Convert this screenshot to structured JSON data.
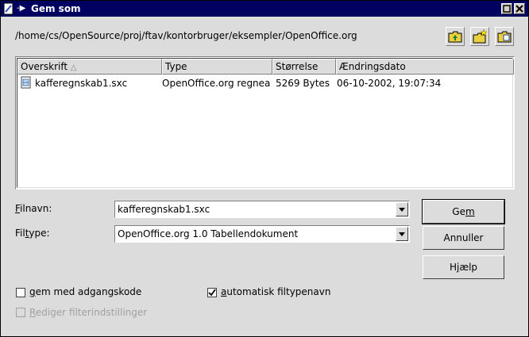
{
  "window": {
    "title": "Gem som",
    "pin_symbol": "-▶"
  },
  "path": "/home/cs/OpenSource/proj/ftav/kontorbruger/eksempler/OpenOffice.org",
  "toolbar": {
    "up_icon": "folder-up-icon",
    "new_folder_icon": "new-folder-icon",
    "default_dir_icon": "default-directory-icon"
  },
  "file_list": {
    "columns": [
      "Overskrift",
      "Type",
      "Størrelse",
      "Ændringsdato"
    ],
    "rows": [
      {
        "name": "kafferegnskab1.sxc",
        "type": "OpenOffice.org regnea",
        "size": "5269 Bytes",
        "date": "06-10-2002, 19:07:34"
      }
    ]
  },
  "form": {
    "filename_label_u": "F",
    "filename_label_rest": "ilnavn:",
    "filename_value": "kafferegnskab1.sxc",
    "filetype_label_pre": "Fil",
    "filetype_label_u": "t",
    "filetype_label_rest": "ype:",
    "filetype_value": "OpenOffice.org 1.0 Tabellendokument"
  },
  "buttons": {
    "save_pre": "Ge",
    "save_u": "m",
    "save_post": "",
    "cancel": "Annuller",
    "help_pre": "H",
    "help_u": "j",
    "help_post": "ælp"
  },
  "options": {
    "password_u": "g",
    "password_rest": "em med adgangskode",
    "password_checked": false,
    "autoext_u": "a",
    "autoext_rest": "utomatisk filtypenavn",
    "autoext_checked": true,
    "filter_u": "R",
    "filter_rest": "ediger filterindstillinger",
    "filter_checked": false
  }
}
